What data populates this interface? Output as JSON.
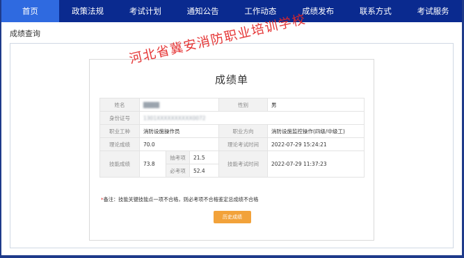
{
  "nav": {
    "items": [
      {
        "label": "首页",
        "active": true
      },
      {
        "label": "政策法规",
        "active": false
      },
      {
        "label": "考试计划",
        "active": false
      },
      {
        "label": "通知公告",
        "active": false
      },
      {
        "label": "工作动态",
        "active": false
      },
      {
        "label": "成绩发布",
        "active": false
      },
      {
        "label": "联系方式",
        "active": false
      },
      {
        "label": "考试服务",
        "active": false
      }
    ]
  },
  "page": {
    "title": "成绩查询"
  },
  "report": {
    "title": "成绩单",
    "seal_text": "河北省冀安消防职业培训学校",
    "name_label": "姓名",
    "name_value": "████",
    "gender_label": "性别",
    "gender_value": "男",
    "id_label": "身份证号",
    "id_value": "1301XXXXXXXXXX0072",
    "occupation_label": "职业工种",
    "occupation_value": "消防设施操作员",
    "direction_label": "职业方向",
    "direction_value": "消防设施监控操作(四级/中级工)",
    "theory_score_label": "理论成绩",
    "theory_score_value": "70.0",
    "theory_time_label": "理论考试时间",
    "theory_time_value": "2022-07-29 15:24:21",
    "skill_score_label": "技能成绩",
    "skill_score_value": "73.8",
    "sample_label": "抽考项",
    "sample_value": "21.5",
    "required_label": "必考项",
    "required_value": "52.4",
    "skill_time_label": "技能考试时间",
    "skill_time_value": "2022-07-29 11:37:23",
    "note_star": "*",
    "note_text": "备注：技能关键技能点一项不合格，则必考项不合格鉴定总成绩不合格",
    "history_button": "历史成绩"
  },
  "colors": {
    "nav_bg": "#0a2a8f",
    "nav_active": "#2f6ae0",
    "seal": "#e32626",
    "button": "#f2a23a"
  }
}
